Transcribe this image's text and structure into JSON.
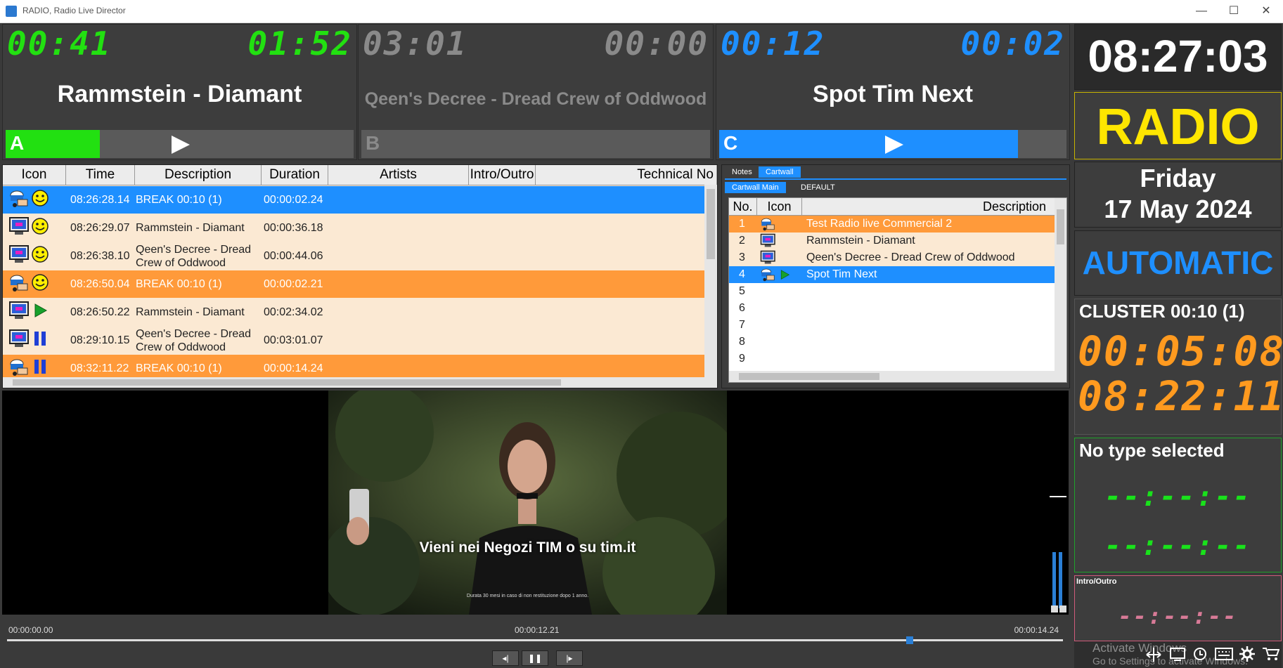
{
  "window": {
    "title": "RADIO, Radio Live Director",
    "minimize": "—",
    "maximize": "☐",
    "close": "✕"
  },
  "decks": [
    {
      "letter": "A",
      "elapsed": "00:41",
      "remaining": "01:52",
      "track": "Rammstein - Diamant",
      "color": "#22e011",
      "progress": 0.27,
      "active": true
    },
    {
      "letter": "B",
      "elapsed": "03:01",
      "remaining": "00:00",
      "track": "Qeen's Decree - Dread Crew of Oddwood",
      "color": "#8a8a8a",
      "progress": 0,
      "active": false
    },
    {
      "letter": "C",
      "elapsed": "00:12",
      "remaining": "00:02",
      "track": "Spot Tim Next",
      "color": "#1e8fff",
      "progress": 0.86,
      "active": true
    }
  ],
  "clock": {
    "time": "08:27:03",
    "station": "RADIO",
    "weekday": "Friday",
    "date": "17 May 2024",
    "mode": "AUTOMATIC"
  },
  "cluster": {
    "title": "CLUSTER 00:10 (1)",
    "time1": "00:05:08",
    "time2": "08:22:11"
  },
  "type_panel": {
    "title": "No type selected",
    "value1": "--:--:--",
    "value2": "--:--:--"
  },
  "intro_outro": {
    "title": "Intro/Outro",
    "value": "--:--:--"
  },
  "watermark": {
    "line1": "Activate Windows",
    "line2": "Go to Settings to activate Windows."
  },
  "playlist": {
    "columns": [
      "Icon",
      "Time",
      "Description",
      "Duration",
      "Artists",
      "Intro/Outro",
      "Technical No"
    ],
    "rows": [
      {
        "time": "08:26:28.14",
        "description": "BREAK 00:10 (1)",
        "duration": "00:00:02.24",
        "kind": "break",
        "state": "smile",
        "style": "selected"
      },
      {
        "time": "08:26:29.07",
        "description": "Rammstein - Diamant",
        "duration": "00:00:36.18",
        "kind": "music",
        "state": "smile",
        "style": "normal"
      },
      {
        "time": "08:26:38.10",
        "description": "Qeen's Decree - Dread Crew of Oddwood",
        "duration": "00:00:44.06",
        "kind": "music",
        "state": "smile",
        "style": "normal"
      },
      {
        "time": "08:26:50.04",
        "description": "BREAK 00:10 (1)",
        "duration": "00:00:02.21",
        "kind": "break",
        "state": "smile",
        "style": "break"
      },
      {
        "time": "08:26:50.22",
        "description": "Rammstein - Diamant",
        "duration": "00:02:34.02",
        "kind": "music",
        "state": "play",
        "style": "normal"
      },
      {
        "time": "08:29:10.15",
        "description": "Qeen's Decree - Dread Crew of Oddwood",
        "duration": "00:03:01.07",
        "kind": "music",
        "state": "pause",
        "style": "normal"
      },
      {
        "time": "08:32:11.22",
        "description": "BREAK 00:10 (1)",
        "duration": "00:00:14.24",
        "kind": "break",
        "state": "pause",
        "style": "break"
      }
    ]
  },
  "cartwall": {
    "tabs": [
      "Notes",
      "Cartwall"
    ],
    "subtabs": [
      "Cartwall Main",
      "DEFAULT"
    ],
    "columns": [
      "No.",
      "Icon",
      "Description"
    ],
    "rows": [
      {
        "no": "1",
        "description": "Test Radio live Commercial 2",
        "kind": "break",
        "style": "orange"
      },
      {
        "no": "2",
        "description": "Rammstein - Diamant",
        "kind": "music",
        "style": "normal"
      },
      {
        "no": "3",
        "description": "Qeen's Decree - Dread Crew of Oddwood",
        "kind": "music",
        "style": "normal"
      },
      {
        "no": "4",
        "description": "Spot Tim Next",
        "kind": "break",
        "style": "selected"
      },
      {
        "no": "5",
        "description": "",
        "kind": "",
        "style": "empty"
      },
      {
        "no": "6",
        "description": "",
        "kind": "",
        "style": "empty"
      },
      {
        "no": "7",
        "description": "",
        "kind": "",
        "style": "empty"
      },
      {
        "no": "8",
        "description": "",
        "kind": "",
        "style": "empty"
      },
      {
        "no": "9",
        "description": "",
        "kind": "",
        "style": "empty"
      }
    ]
  },
  "video": {
    "subtitle": "Vieni nei Negozi TIM o su tim.it",
    "fine_print": "Durata 30 mesi in caso di non restituzione dopo 1 anno."
  },
  "transport": {
    "start": "00:00:00.00",
    "current": "00:00:12.21",
    "end": "00:00:14.24",
    "progress": 0.855,
    "prev": "◂|",
    "pause": "❚❚",
    "next": "|▸"
  },
  "icons": {
    "break": "cart-icon",
    "music": "monitor-icon",
    "smile": "smiley-icon",
    "play": "play-icon",
    "pause": "pause-icon"
  }
}
